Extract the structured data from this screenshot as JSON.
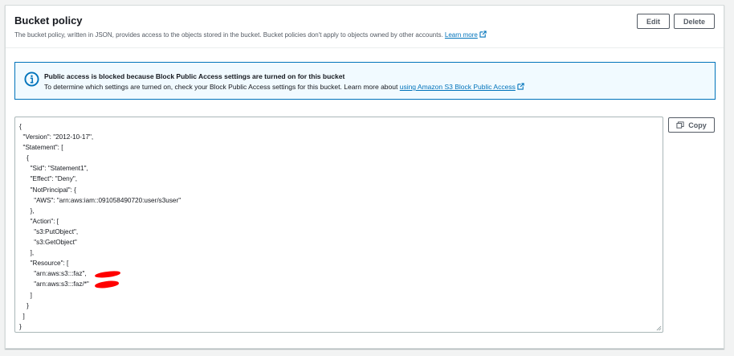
{
  "header": {
    "title": "Bucket policy",
    "description": "The bucket policy, written in JSON, provides access to the objects stored in the bucket. Bucket policies don't apply to objects owned by other accounts.",
    "learn_more": "Learn more",
    "edit_label": "Edit",
    "delete_label": "Delete"
  },
  "alert": {
    "title": "Public access is blocked because Block Public Access settings are turned on for this bucket",
    "body": "To determine which settings are turned on, check your Block Public Access settings for this bucket. Learn more about",
    "link": "using Amazon S3 Block Public Access"
  },
  "editor": {
    "code": "{\n  \"Version\": \"2012-10-17\",\n  \"Statement\": [\n    {\n      \"Sid\": \"Statement1\",\n      \"Effect\": \"Deny\",\n      \"NotPrincipal\": {\n        \"AWS\": \"arn:aws:iam::091058490720:user/s3user\"\n      },\n      \"Action\": [\n        \"s3:PutObject\",\n        \"s3:GetObject\"\n      ],\n      \"Resource\": [\n        \"arn:aws:s3:::faz\",\n        \"arn:aws:s3:::faz/*\"\n      ]\n    }\n  ]\n}",
    "copy_label": "Copy"
  },
  "colors": {
    "link": "#0073bb",
    "alert_border": "#0073bb",
    "alert_bg": "#f1faff",
    "redaction": "#ff0000"
  },
  "icons": {
    "info": "info-circle-icon",
    "external": "external-link-icon",
    "copy": "copy-icon"
  }
}
